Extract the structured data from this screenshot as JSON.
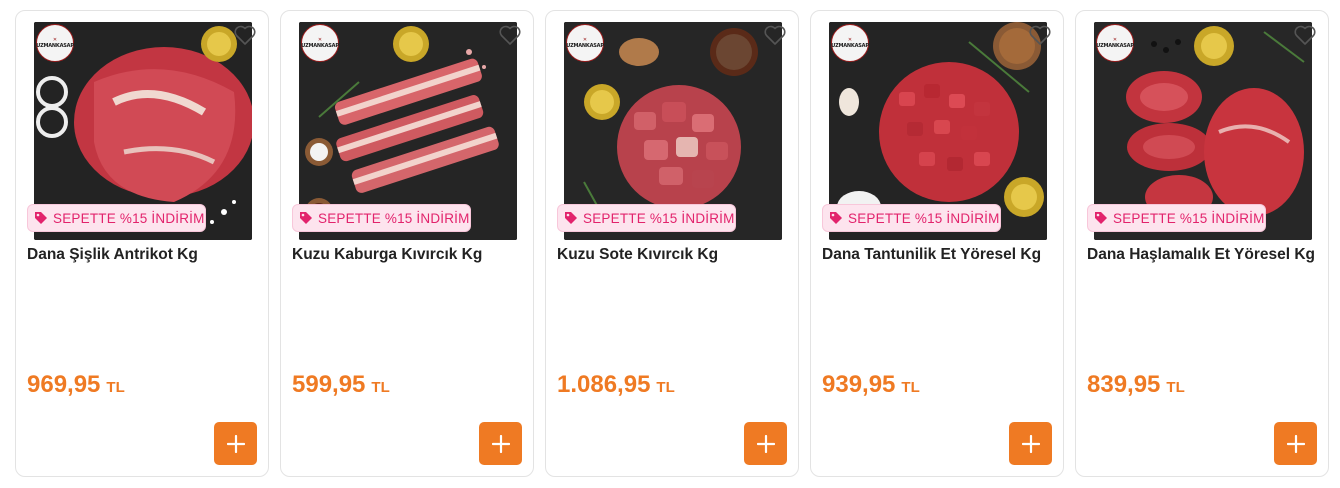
{
  "products": [
    {
      "brand": "UZMANKASAP",
      "badge": "SEPETTE %15 İNDİRİM",
      "title": "Dana Şişlik Antrikot Kg",
      "price": "969,95",
      "currency": "TL"
    },
    {
      "brand": "UZMANKASAP",
      "badge": "SEPETTE %15 İNDİRİM",
      "title": "Kuzu Kaburga Kıvırcık Kg",
      "price": "599,95",
      "currency": "TL"
    },
    {
      "brand": "UZMANKASAP",
      "badge": "SEPETTE %15 İNDİRİM",
      "title": "Kuzu Sote Kıvırcık Kg",
      "price": "1.086,95",
      "currency": "TL"
    },
    {
      "brand": "UZMANKASAP",
      "badge": "SEPETTE %15 İNDİRİM",
      "title": "Dana Tantunilik Et Yöresel Kg",
      "price": "939,95",
      "currency": "TL"
    },
    {
      "brand": "UZMANKASAP",
      "badge": "SEPETTE %15 İNDİRİM",
      "title": "Dana Haşlamalık Et Yöresel Kg",
      "price": "839,95",
      "currency": "TL"
    }
  ],
  "icons": {
    "favorite": "heart-outline-icon",
    "badge": "tag-icon",
    "add": "plus-icon"
  },
  "colors": {
    "accent": "#ef7a23",
    "badge_text": "#e2236c",
    "badge_bg": "#fde4ee",
    "title": "#222222"
  }
}
